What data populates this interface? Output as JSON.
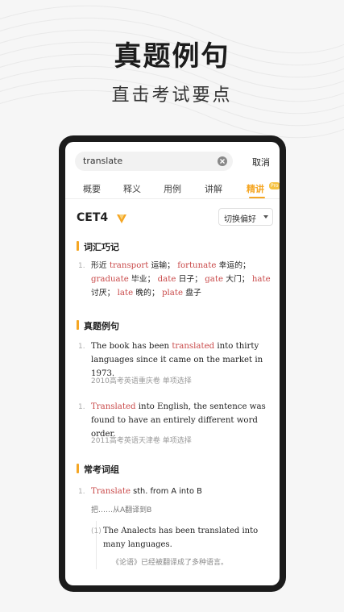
{
  "headline": "真题例句",
  "subline": "直击考试要点",
  "search": {
    "value": "translate",
    "cancel_label": "取消"
  },
  "tabs": [
    {
      "label": "概要"
    },
    {
      "label": "释义"
    },
    {
      "label": "用例"
    },
    {
      "label": "讲解"
    },
    {
      "label": "精讲"
    }
  ],
  "pro_badge": "Pro",
  "level": "CET4",
  "preference_label": "切换偏好",
  "sections": {
    "vocab_title": "词汇巧记",
    "exam_title": "真题例句",
    "phrase_title": "常考词组"
  },
  "vocab": {
    "num": "1.",
    "w1": "形近",
    "e1": "transport",
    "c1": "运输；",
    "e2": "fortunate",
    "c2": "幸运的；",
    "e3": "graduate",
    "c3": "毕业；",
    "e4": "date",
    "c4": "日子；",
    "e5": "gate",
    "c5": "大门；",
    "e6": "hate",
    "c6": "讨厌；",
    "e7": "late",
    "c7": "晚的；",
    "e8": "plate",
    "c8": "盘子"
  },
  "exam": [
    {
      "num": "1.",
      "pre": "The book has been ",
      "hl": "translated",
      "post": " into thirty languages since it came on the market in 1973.",
      "source": "2010高考英语重庆卷 单项选择"
    },
    {
      "num": "1.",
      "pre": "",
      "hl": "Translated",
      "post": " into English, the sentence was found to have an entirely different word order.",
      "source": "2011高考英语天津卷 单项选择"
    }
  ],
  "phrase": {
    "num": "1.",
    "hl": "Translate",
    "rest": " sth. from A into B",
    "cn": "把……从A翻译到B",
    "sub_num": "(1)",
    "example": "The Analects has been translated into many languages.",
    "example_cn": "《论语》已经被翻译成了多种语言。"
  },
  "colors": {
    "accent": "#f5a623",
    "highlight": "#c94a4a"
  },
  "icons": [
    "clear-icon",
    "cet-badge-icon",
    "chevron-down-icon"
  ]
}
